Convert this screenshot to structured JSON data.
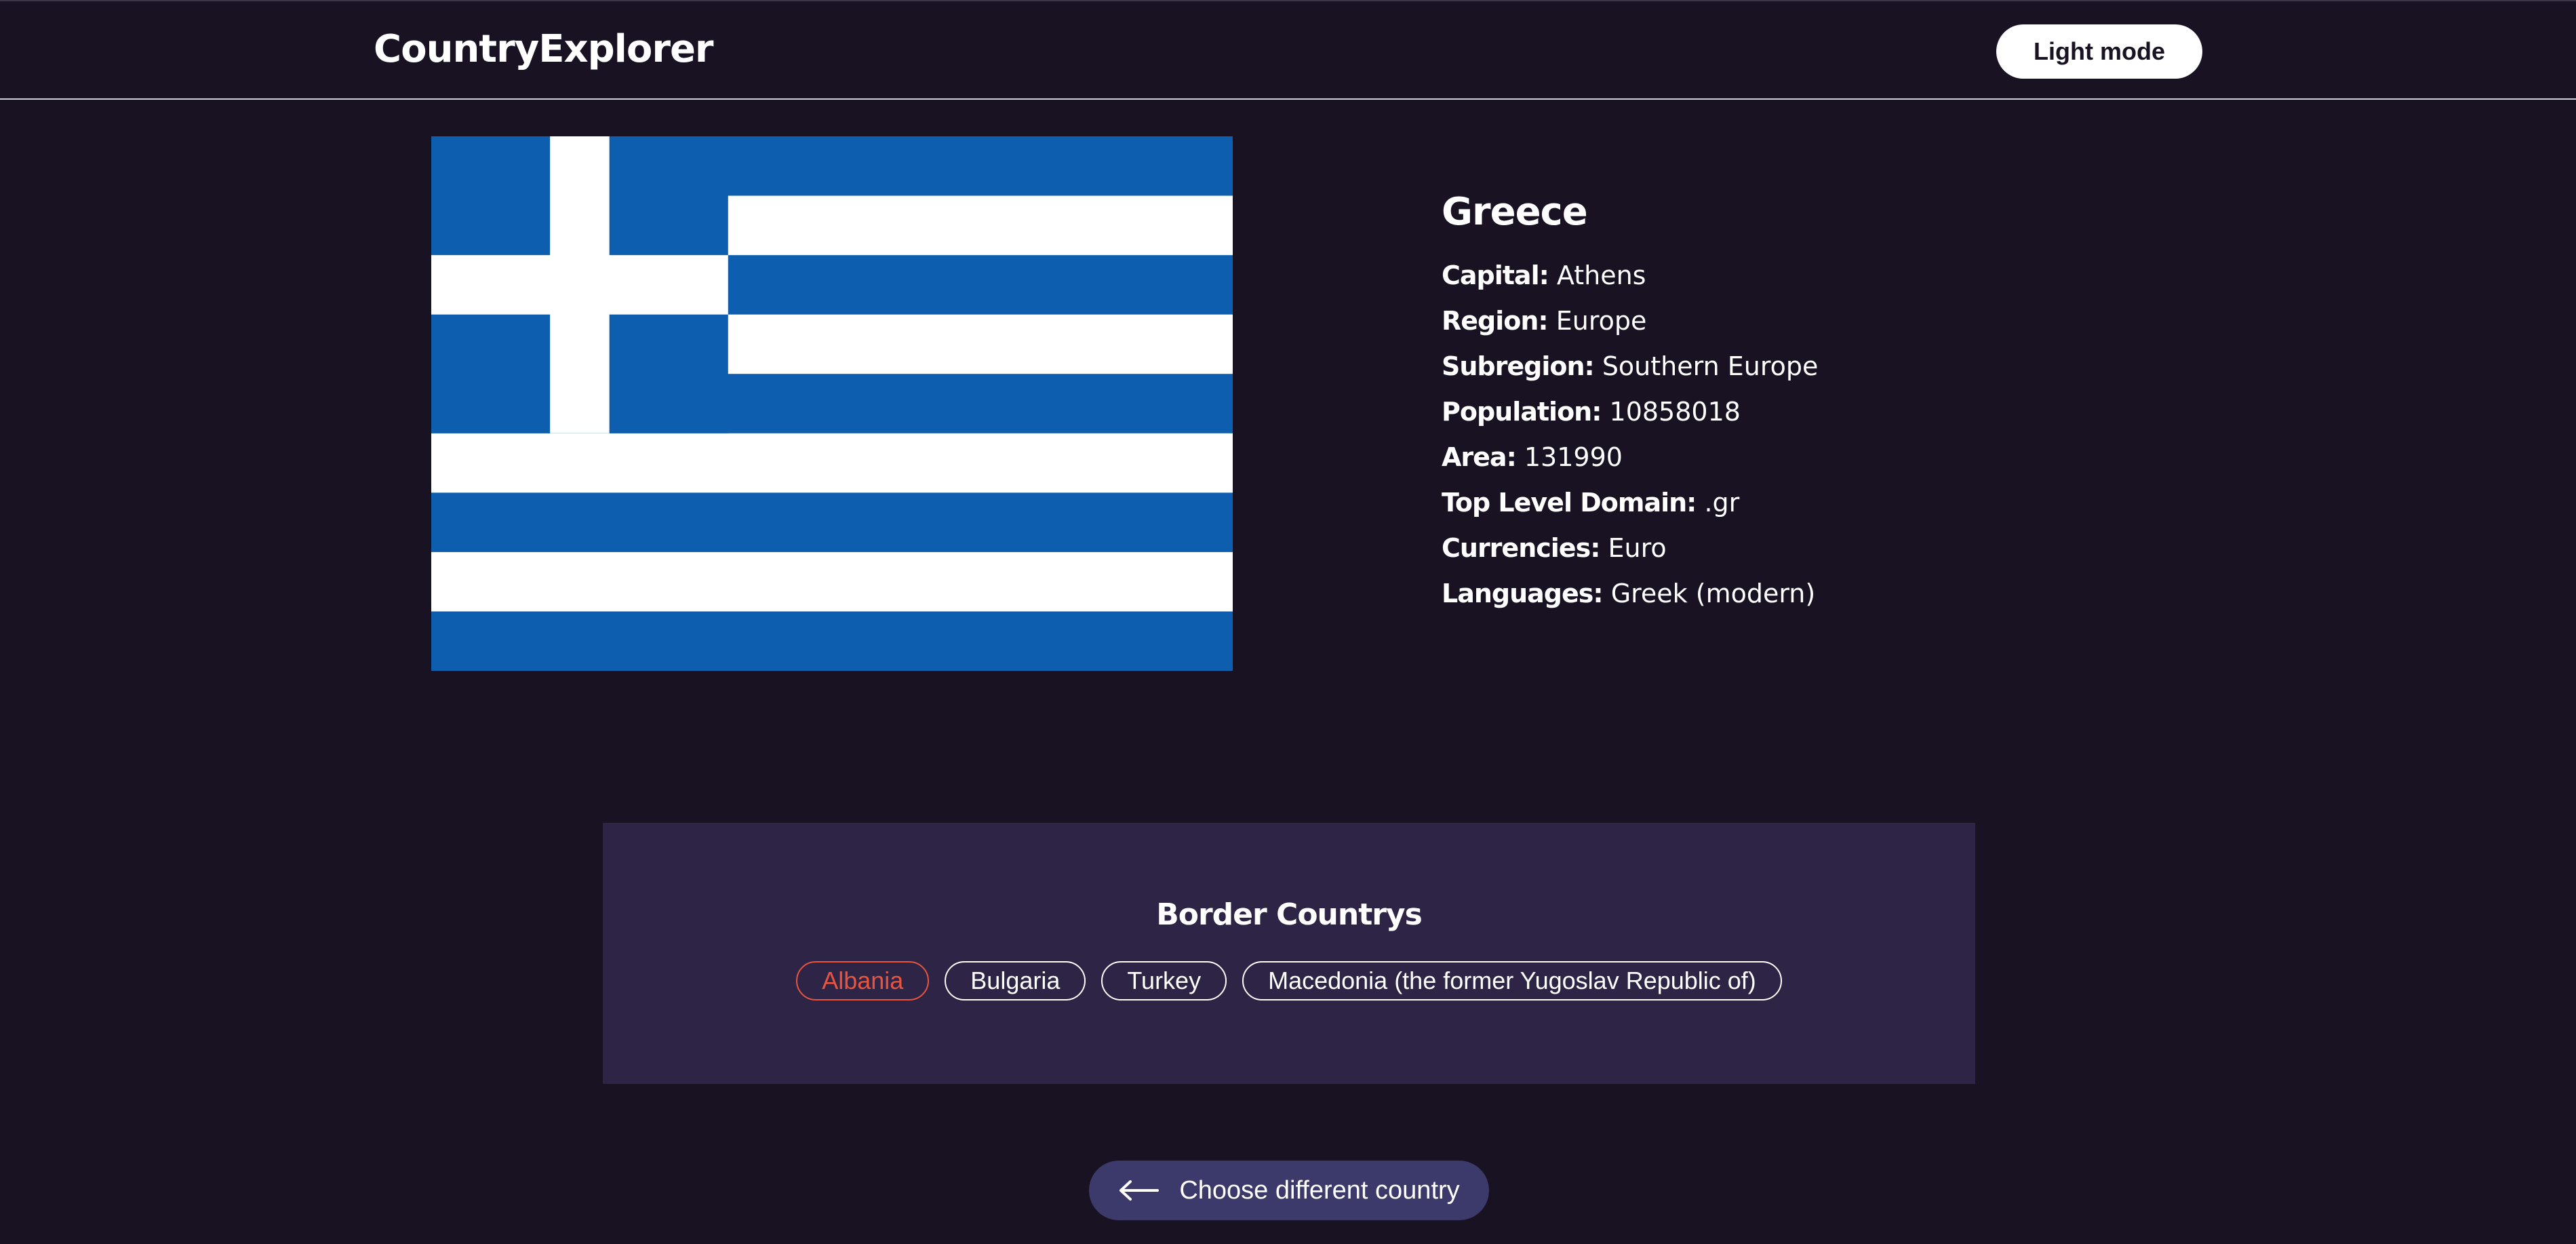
{
  "header": {
    "logo": "CountryExplorer",
    "mode_button": "Light mode"
  },
  "flag": {
    "icon": "greece-flag",
    "colors": {
      "blue": "#0d5eaf",
      "white": "#ffffff"
    }
  },
  "country": {
    "name": "Greece",
    "details": [
      {
        "key": "Capital:",
        "value": "Athens"
      },
      {
        "key": "Region:",
        "value": "Europe"
      },
      {
        "key": "Subregion:",
        "value": "Southern Europe"
      },
      {
        "key": "Population:",
        "value": "10858018"
      },
      {
        "key": "Area:",
        "value": "131990"
      },
      {
        "key": "Top Level Domain:",
        "value": ".gr"
      },
      {
        "key": "Currencies:",
        "value": "Euro"
      },
      {
        "key": "Languages:",
        "value": "Greek (modern)"
      }
    ]
  },
  "borders": {
    "title": "Border Countrys",
    "countries": [
      "Albania",
      "Bulgaria",
      "Turkey",
      "Macedonia (the former Yugoslav Republic of)"
    ],
    "highlight_color": "#e8553f"
  },
  "back_button": {
    "label": "Choose different country",
    "icon": "arrow-left-icon"
  },
  "colors": {
    "background": "#181223",
    "panel": "#2e2445",
    "back_button": "#3b3a6a"
  }
}
